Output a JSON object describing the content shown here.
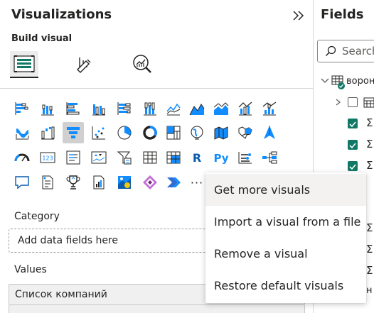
{
  "visualizations_pane": {
    "title": "Visualizations",
    "collapse_icon": "double-chevron-right-icon",
    "build_visual_label": "Build visual",
    "modes": [
      {
        "name": "build-visual",
        "icon": "build-visual-icon",
        "selected": true
      },
      {
        "name": "format-visual",
        "icon": "format-visual-icon",
        "selected": false
      },
      {
        "name": "analytics",
        "icon": "analytics-magnifier-icon",
        "selected": false
      }
    ],
    "visual_icons": {
      "row1": [
        "stacked-bar-chart-icon",
        "stacked-column-chart-icon",
        "clustered-bar-chart-icon",
        "clustered-column-chart-icon",
        "100-stacked-bar-chart-icon",
        "100-stacked-column-chart-icon",
        "line-chart-icon",
        "area-chart-icon",
        "stacked-area-chart-icon",
        "line-clustered-column-chart-icon",
        "line-stacked-column-chart-icon"
      ],
      "row2": [
        "ribbon-chart-icon",
        "waterfall-chart-icon",
        "funnel-icon",
        "scatter-chart-icon",
        "pie-chart-icon",
        "donut-chart-icon",
        "treemap-icon",
        "map-icon",
        "filled-map-icon",
        "shape-map-icon",
        "azure-map-icon"
      ],
      "row3": [
        "gauge-icon",
        "card-icon",
        "multi-row-card-icon",
        "kpi-icon",
        "slicer-icon",
        "table-icon",
        "matrix-icon",
        "r-visual-icon",
        "python-visual-icon",
        "key-influencers-icon",
        "decomposition-tree-icon"
      ],
      "row4": [
        "qa-icon",
        "smart-narrative-icon",
        "metrics-trophy-icon",
        "paginated-report-icon",
        "arcgis-map-icon",
        "power-apps-icon",
        "power-automate-icon",
        "more-options-icon"
      ],
      "r_label": "R",
      "py_label": "Py",
      "card_label": "123",
      "more_label": "···"
    },
    "category_label": "Category",
    "category_placeholder": "Add data fields here",
    "values_label": "Values",
    "values_field": "Список компаний"
  },
  "fields_pane": {
    "title": "Fields",
    "search_placeholder": "Search",
    "search_icon": "search-icon",
    "table_name": "ворон",
    "field_states": [
      false,
      true,
      true,
      true
    ]
  },
  "context_menu": {
    "items": [
      {
        "label": "Get more visuals",
        "hover": true
      },
      {
        "label": "Import a visual from a file",
        "hover": false
      },
      {
        "label": "Remove a visual",
        "hover": false
      },
      {
        "label": "Restore default visuals",
        "hover": false
      }
    ]
  },
  "colors": {
    "accent_teal": "#117865",
    "icon_blue": "#118dff",
    "icon_dark": "#252423",
    "menu_hover": "#f3f2f1",
    "selected_bg": "#d0d0d0"
  }
}
